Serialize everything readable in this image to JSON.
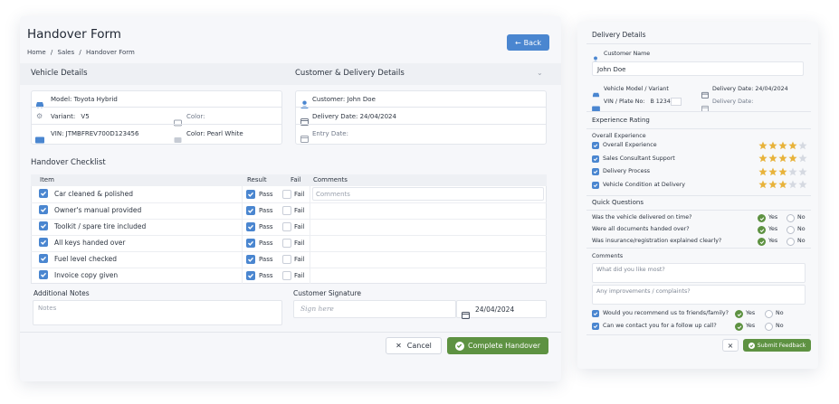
{
  "main": {
    "title": "Handover Form",
    "breadcrumb": [
      "Home",
      "Sales",
      "Handover Form"
    ],
    "back_label": "Back",
    "vehicle_header": "Vehicle Details",
    "customer_header": "Customer & Delivery Details",
    "vehicle": {
      "model": "Model: Toyota Hybrid",
      "variant": "Variant:",
      "variant_value": "V5",
      "color_label": "Color:",
      "vin": "VIN: JTMBFREV700D123456",
      "color": "Color: Pearl White"
    },
    "customer": {
      "customer": "Customer: John Doe",
      "delivery": "Delivery Date: 24/04/2024",
      "entry": "Entry Date:"
    },
    "checklist_header": "Handover Checklist",
    "columns": [
      "Item",
      "Result",
      "Fail",
      "Comments"
    ],
    "pass_label": "Pass",
    "fail_label": "Fail",
    "comments_placeholder": "Comments",
    "items": [
      "Car cleaned & polished",
      "Owner's manual provided",
      "Toolkit / spare tire included",
      "All keys handed over",
      "Fuel level checked",
      "Invoice copy given"
    ],
    "notes_label": "Additional Notes",
    "notes_placeholder": "Notes",
    "signature_label": "Customer Signature",
    "signature_placeholder": "Sign here",
    "signature_date": "24/04/2024",
    "cancel_label": "Cancel",
    "complete_label": "Complete Handover"
  },
  "side": {
    "title": "Delivery Details",
    "customer_name_label": "Customer Name",
    "customer_name": "John Doe",
    "model_label": "Vehicle Model / Variant",
    "delivery_date": "Delivery Date: 24/04/2024",
    "vin_label": "VIN / Plate No:",
    "vin_value": "B 1234",
    "delivery_date2": "Delivery Date:",
    "rating_header": "Experience Rating",
    "overall_header": "Overall Experience",
    "ratings": [
      {
        "label": "Overall Experience",
        "stars": 4
      },
      {
        "label": "Sales Consultant Support",
        "stars": 4
      },
      {
        "label": "Delivery Process",
        "stars": 3
      },
      {
        "label": "Vehicle Condition at Delivery",
        "stars": 3
      }
    ],
    "questions_header": "Quick Questions",
    "questions": [
      "Was the vehicle delivered on time?",
      "Were all documents handed over?",
      "Was insurance/registration explained clearly?"
    ],
    "yes_label": "Yes",
    "no_label": "No",
    "comments_label": "Comments",
    "like_placeholder": "What did you like most?",
    "improve_placeholder": "Any improvements / complaints?",
    "recommend": "Would you recommend us to friends/family?",
    "contact": "Can we contact you for a follow up call?",
    "close_label": "×",
    "submit_label": "Submit Feedback"
  },
  "colors": {
    "accent_blue": "#4a86d0",
    "success_green": "#5e9242",
    "star_gold": "#e8b33b"
  }
}
